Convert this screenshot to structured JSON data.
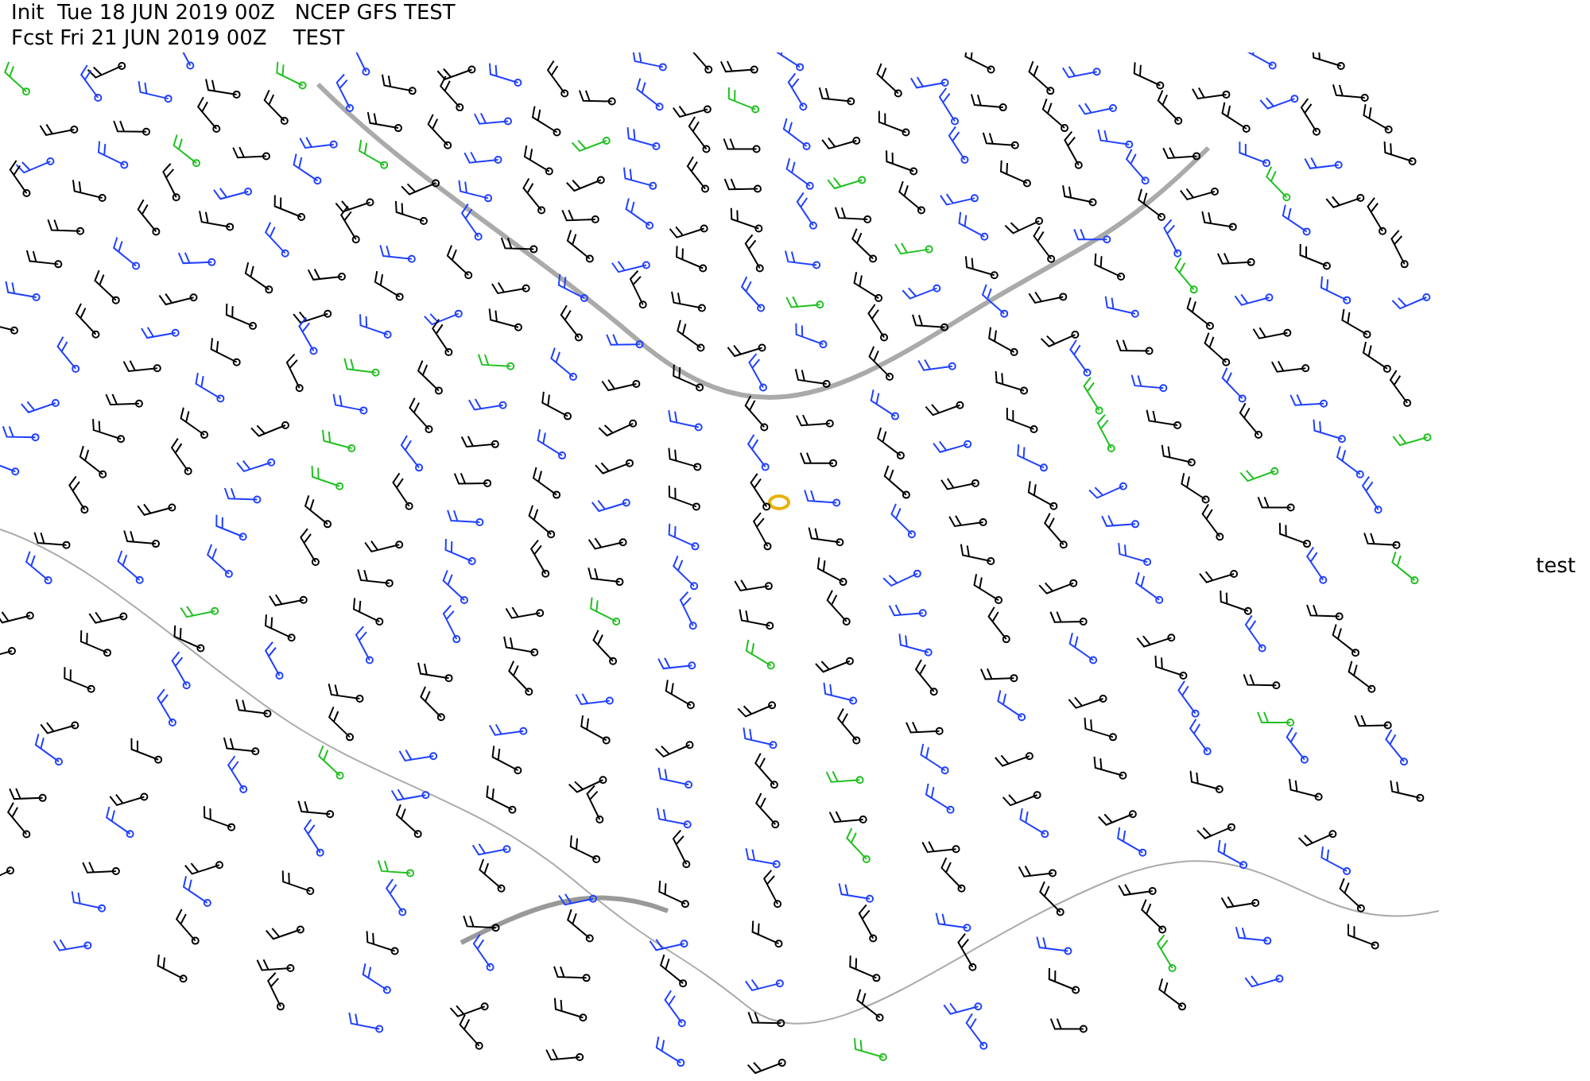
{
  "header": {
    "init_line": "Init  Tue 18 JUN 2019 00Z   NCEP GFS TEST",
    "forecast_line": "Fcst Fri 21 JUN 2019 00Z    TEST"
  },
  "map": {
    "side_label": "test"
  }
}
